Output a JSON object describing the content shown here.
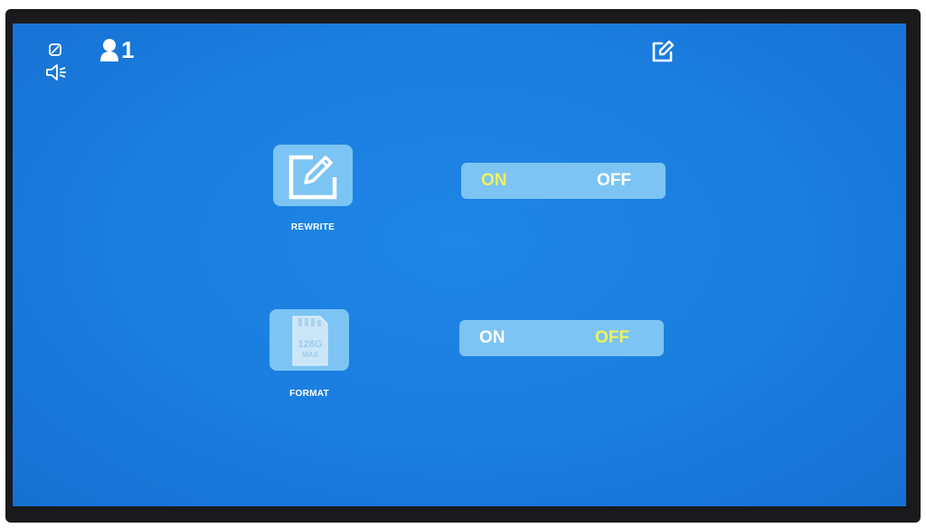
{
  "status_bar": {
    "user_count": "1",
    "icons": [
      "camera-off-icon",
      "speaker-icon",
      "user-icon",
      "edit-icon"
    ]
  },
  "settings": [
    {
      "label": "REWRITE",
      "icon": "edit-square-icon",
      "on_label": "ON",
      "off_label": "OFF",
      "selected": "ON"
    },
    {
      "label": "FORMAT",
      "icon": "sd-card-icon",
      "on_label": "ON",
      "off_label": "OFF",
      "selected": "OFF"
    }
  ],
  "sd_card": {
    "line1": "128G",
    "line2": "MAX"
  },
  "colors": {
    "background": "#1a7ddf",
    "panel": "#7cc4f3",
    "active_text": "#f3f15a",
    "inactive_text": "#ffffff"
  }
}
